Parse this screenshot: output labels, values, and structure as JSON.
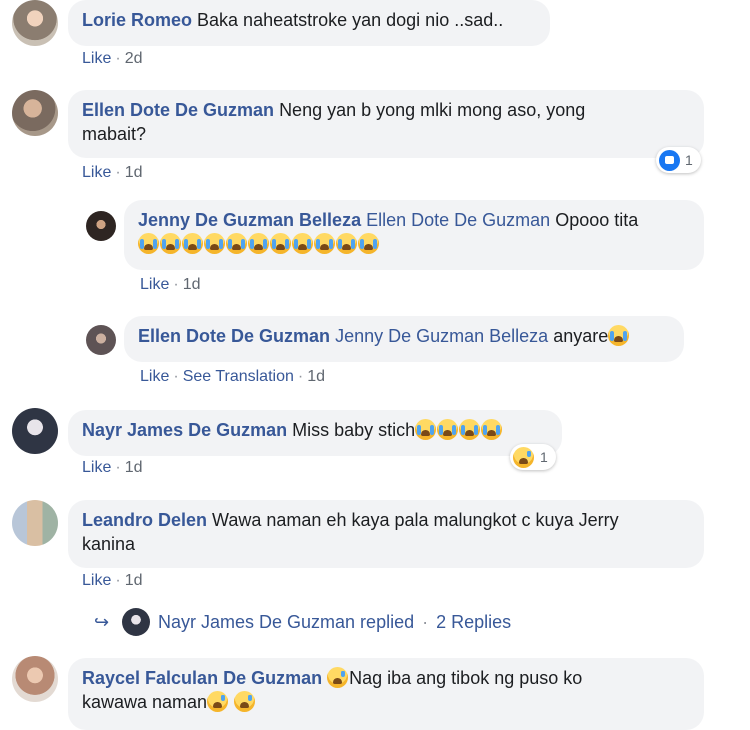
{
  "comments": [
    {
      "author": "Lorie Romeo",
      "text": "Baka naheatstroke yan dogi nio ..sad..",
      "like": "Like",
      "time": "2d"
    },
    {
      "author": "Ellen Dote De Guzman",
      "text_line1": "Neng yan b yong mlki mong aso, yong",
      "text_line2": "mabait?",
      "like": "Like",
      "time": "1d",
      "reaction_count": "1"
    },
    {
      "author": "Jenny De Guzman Belleza",
      "mention": "Ellen Dote De Guzman",
      "text": "Opooo tita",
      "like": "Like",
      "time": "1d"
    },
    {
      "author": "Ellen Dote De Guzman",
      "mention": "Jenny De Guzman Belleza",
      "text": "anyare",
      "like": "Like",
      "translate": "See Translation",
      "time": "1d"
    },
    {
      "author": "Nayr James De Guzman",
      "text": "Miss baby stich",
      "like": "Like",
      "time": "1d",
      "reaction_count": "1"
    },
    {
      "author": "Leandro Delen",
      "text_line1": "Wawa naman eh kaya pala malungkot c kuya Jerry",
      "text_line2": "kanina",
      "like": "Like",
      "time": "1d",
      "replied_text": "Nayr James De Guzman replied",
      "replies_count": "2 Replies"
    },
    {
      "author": "Raycel Falculan De Guzman",
      "text_line1": "Nag iba ang tibok ng puso ko",
      "text_line2": "kawawa naman",
      "like": "",
      "time": ""
    }
  ],
  "separator": "·",
  "colors": {
    "link": "#385898",
    "bubble": "#f2f3f5",
    "like_badge": "#1877f2"
  }
}
